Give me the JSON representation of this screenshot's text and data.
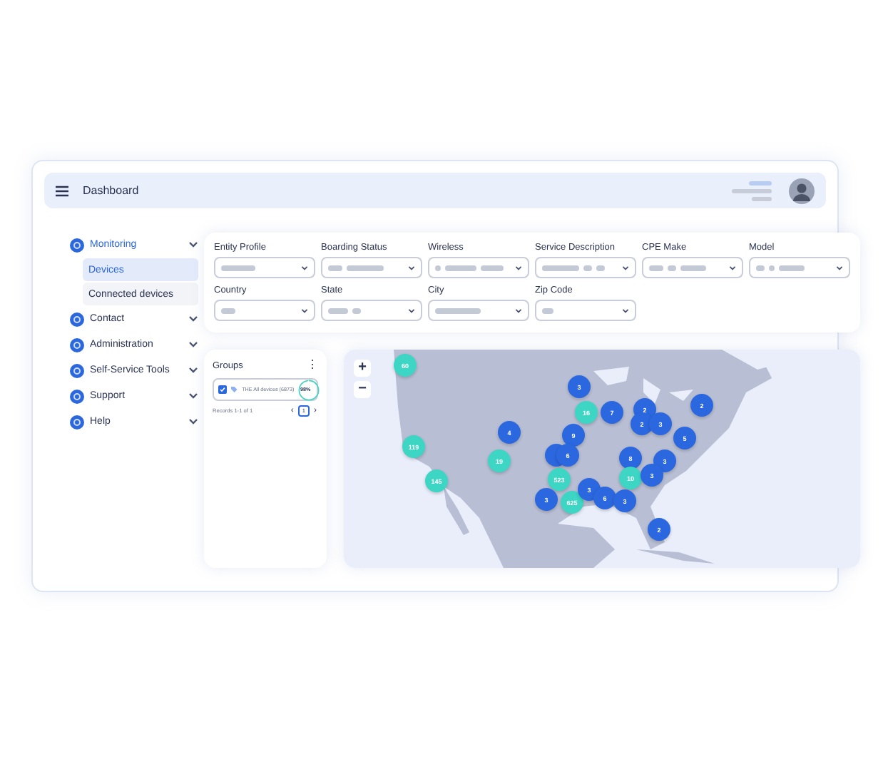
{
  "header": {
    "title": "Dashboard"
  },
  "sidebar": {
    "items": [
      {
        "label": "Monitoring",
        "selected": true,
        "children": [
          {
            "label": "Devices",
            "selected": true
          },
          {
            "label": "Connected devices",
            "selected": false
          }
        ]
      },
      {
        "label": "Contact",
        "selected": false
      },
      {
        "label": "Administration",
        "selected": false
      },
      {
        "label": "Self-Service Tools",
        "selected": false
      },
      {
        "label": "Support",
        "selected": false
      },
      {
        "label": "Help",
        "selected": false
      }
    ]
  },
  "filters": [
    {
      "label": "Entity Profile"
    },
    {
      "label": "Boarding Status"
    },
    {
      "label": "Wireless"
    },
    {
      "label": "Service Description"
    },
    {
      "label": "CPE Make"
    },
    {
      "label": "Model"
    },
    {
      "label": "Country"
    },
    {
      "label": "State"
    },
    {
      "label": "City"
    },
    {
      "label": "Zip Code"
    }
  ],
  "groups": {
    "title": "Groups",
    "menu": "⋮",
    "items": [
      {
        "label": "THE All devices (6873)",
        "checked": true,
        "badge": "98%",
        "level": 0.98
      }
    ],
    "records": "Records 1-1 of 1",
    "pager": {
      "prev": "‹",
      "page": "1",
      "next": "›"
    }
  },
  "map": {
    "zoom_in": "+",
    "zoom_out": "−",
    "markers": [
      {
        "label": "60",
        "color": "#3dd5c4"
      },
      {
        "label": "3",
        "color": "#2b67df"
      },
      {
        "label": "16",
        "color": "#3dd5c4"
      },
      {
        "label": "7",
        "color": "#2b67df"
      },
      {
        "label": "2",
        "color": "#2b67df"
      },
      {
        "label": "2",
        "color": "#2b67df"
      },
      {
        "label": "2",
        "color": "#2b67df"
      },
      {
        "label": "3",
        "color": "#2b67df"
      },
      {
        "label": "4",
        "color": "#2b67df"
      },
      {
        "label": "9",
        "color": "#2b67df"
      },
      {
        "label": "5",
        "color": "#2b67df"
      },
      {
        "label": "119",
        "color": "#3dd5c4"
      },
      {
        "label": "19",
        "color": "#3dd5c4"
      },
      {
        "color": "#2b67df"
      },
      {
        "label": "6",
        "color": "#2b67df"
      },
      {
        "label": "8",
        "color": "#2b67df"
      },
      {
        "label": "3",
        "color": "#2b67df"
      },
      {
        "label": "145",
        "color": "#3dd5c4"
      },
      {
        "label": "523",
        "color": "#3dd5c4"
      },
      {
        "label": "10",
        "color": "#3dd5c4"
      },
      {
        "label": "3",
        "color": "#2b67df"
      },
      {
        "label": "3",
        "color": "#2b67df"
      },
      {
        "label": "625",
        "color": "#3dd5c4"
      },
      {
        "label": "3",
        "color": "#2b67df"
      },
      {
        "label": "6",
        "color": "#2b67df"
      },
      {
        "label": "3",
        "color": "#2b67df"
      },
      {
        "label": "2",
        "color": "#2b67df"
      }
    ]
  }
}
